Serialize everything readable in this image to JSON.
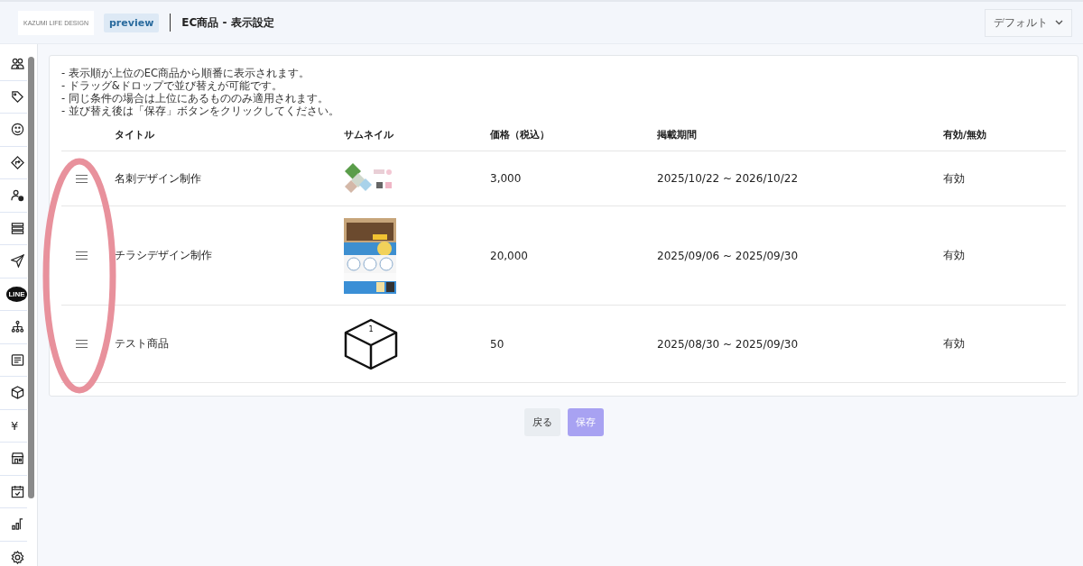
{
  "header": {
    "logo_text": "KAZUMI LIFE DESIGN",
    "badge": "preview",
    "title": "EC商品 - 表示設定",
    "dropdown": "デフォルト"
  },
  "sidebar": {
    "line_label": "LINE",
    "currency": "¥"
  },
  "notes": [
    "- 表示順が上位のEC商品から順番に表示されます。",
    "- ドラッグ&ドロップで並び替えが可能です。",
    "- 同じ条件の場合は上位にあるもののみ適用されます。",
    "- 並び替え後は「保存」ボタンをクリックしてください。"
  ],
  "table": {
    "columns": [
      "タイトル",
      "サムネイル",
      "価格（税込）",
      "掲載期間",
      "有効/無効"
    ],
    "rows": [
      {
        "title": "名刺デザイン制作",
        "price": "3,000",
        "period": "2025/10/22 ~ 2026/10/22",
        "status": "有効"
      },
      {
        "title": "チラシデザイン制作",
        "price": "20,000",
        "period": "2025/09/06 ~ 2025/09/30",
        "status": "有効"
      },
      {
        "title": "テスト商品",
        "thumbnail": {
          "kind": "placeholder",
          "label": "1"
        },
        "price": "50",
        "period": "2025/08/30 ~ 2025/09/30",
        "status": "有効"
      }
    ]
  },
  "buttons": {
    "back": "戻る",
    "save": "保存"
  }
}
